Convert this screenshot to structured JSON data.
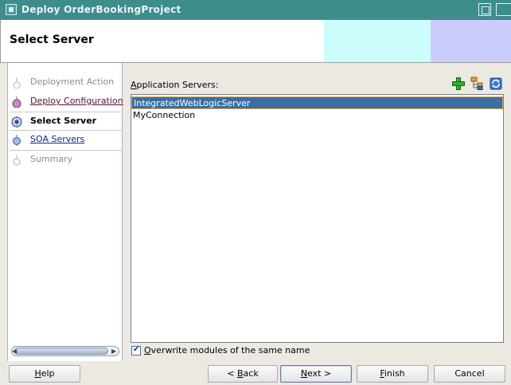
{
  "window": {
    "title": "Deploy OrderBookingProject"
  },
  "header": {
    "title": "Select Server"
  },
  "nav": {
    "steps": [
      {
        "label": "Deployment Action",
        "state": "disabled"
      },
      {
        "label": "Deploy Configuration",
        "state": "visited"
      },
      {
        "label": "Select Server",
        "state": "current"
      },
      {
        "label": "SOA Servers",
        "state": "todo"
      },
      {
        "label": "Summary",
        "state": "disabled"
      }
    ]
  },
  "main": {
    "servers_label_mnemonic": "A",
    "servers_label_rest": "pplication Servers:",
    "tools": {
      "add_icon": "plus-icon",
      "browse_icon": "server-browse-icon",
      "refresh_icon": "refresh-icon"
    },
    "servers": [
      {
        "name": "IntegratedWebLogicServer",
        "selected": true
      },
      {
        "name": "MyConnection",
        "selected": false
      }
    ],
    "overwrite_checked": true,
    "overwrite_mnemonic": "O",
    "overwrite_rest": "verwrite modules of the same name"
  },
  "buttons": {
    "help": {
      "mn": "H",
      "rest": "elp"
    },
    "back": {
      "pre": "< ",
      "mn": "B",
      "rest": "ack"
    },
    "next": {
      "mn": "N",
      "rest": "ext >"
    },
    "finish": {
      "mn": "F",
      "rest": "inish"
    },
    "cancel": {
      "label": "Cancel"
    }
  },
  "colors": {
    "titlebar": "#3d8d8d",
    "selection": "#3a6ea5",
    "header_cyan": "#ccfcfc",
    "header_lavender": "#ccccfc"
  }
}
